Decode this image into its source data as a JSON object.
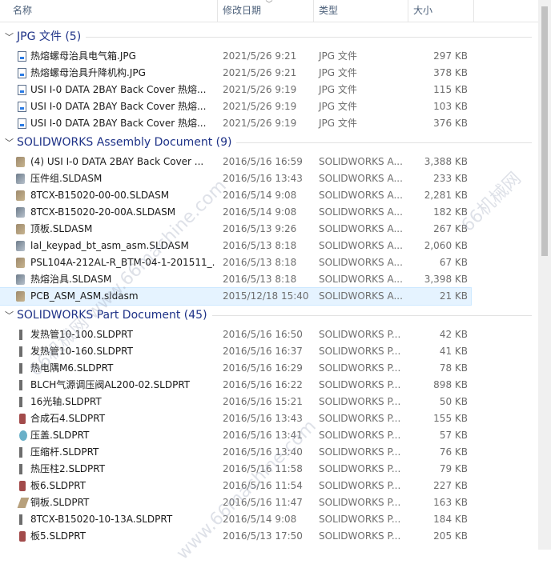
{
  "header": {
    "name": "名称",
    "date": "修改日期",
    "type": "类型",
    "size": "大小"
  },
  "groups": [
    {
      "title": "JPG 文件 (5)",
      "rows": [
        {
          "name": "热熔螺母治具电气箱.JPG",
          "date": "2021/5/26 9:21",
          "type": "JPG 文件",
          "size": "297 KB",
          "icon": "jpg-file-icon"
        },
        {
          "name": "热熔螺母治具升降机构.JPG",
          "date": "2021/5/26 9:21",
          "type": "JPG 文件",
          "size": "378 KB",
          "icon": "jpg-file-icon"
        },
        {
          "name": "USI I-0 DATA 2BAY Back Cover 热熔...",
          "date": "2021/5/26 9:19",
          "type": "JPG 文件",
          "size": "115 KB",
          "icon": "jpg-file-icon"
        },
        {
          "name": "USI I-0 DATA 2BAY Back Cover 热熔...",
          "date": "2021/5/26 9:19",
          "type": "JPG 文件",
          "size": "103 KB",
          "icon": "jpg-file-icon"
        },
        {
          "name": "USI I-0 DATA 2BAY Back Cover 热熔...",
          "date": "2021/5/26 9:19",
          "type": "JPG 文件",
          "size": "376 KB",
          "icon": "jpg-file-icon"
        }
      ]
    },
    {
      "title": "SOLIDWORKS Assembly Document (9)",
      "rows": [
        {
          "name": "(4) USI I-0 DATA 2BAY Back Cover ...",
          "date": "2016/5/16 16:59",
          "type": "SOLIDWORKS A...",
          "size": "3,388 KB",
          "icon": "assembly-icon"
        },
        {
          "name": "压件组.SLDASM",
          "date": "2016/5/16 13:43",
          "type": "SOLIDWORKS A...",
          "size": "233 KB",
          "icon": "assembly-icon"
        },
        {
          "name": "8TCX-B15020-00-00.SLDASM",
          "date": "2016/5/14 9:08",
          "type": "SOLIDWORKS A...",
          "size": "2,281 KB",
          "icon": "assembly-icon"
        },
        {
          "name": "8TCX-B15020-20-00A.SLDASM",
          "date": "2016/5/14 9:08",
          "type": "SOLIDWORKS A...",
          "size": "182 KB",
          "icon": "assembly-icon"
        },
        {
          "name": "顶板.SLDASM",
          "date": "2016/5/13 9:26",
          "type": "SOLIDWORKS A...",
          "size": "267 KB",
          "icon": "assembly-icon"
        },
        {
          "name": "lal_keypad_bt_asm_asm.SLDASM",
          "date": "2016/5/13 8:18",
          "type": "SOLIDWORKS A...",
          "size": "2,060 KB",
          "icon": "assembly-icon"
        },
        {
          "name": "PSL104A-212AL-R_BTM-04-1-201511_...",
          "date": "2016/5/13 8:18",
          "type": "SOLIDWORKS A...",
          "size": "67 KB",
          "icon": "assembly-icon"
        },
        {
          "name": "热熔治具.SLDASM",
          "date": "2016/5/13 8:18",
          "type": "SOLIDWORKS A...",
          "size": "3,398 KB",
          "icon": "assembly-icon"
        },
        {
          "name": "PCB_ASM_ASM.sldasm",
          "date": "2015/12/18 15:40",
          "type": "SOLIDWORKS A...",
          "size": "21 KB",
          "icon": "assembly-icon",
          "selected": true
        }
      ]
    },
    {
      "title": "SOLIDWORKS Part Document (45)",
      "rows": [
        {
          "name": "发热管10-100.SLDPRT",
          "date": "2016/5/16 16:50",
          "type": "SOLIDWORKS P...",
          "size": "42 KB",
          "icon": "part-icon"
        },
        {
          "name": "发热管10-160.SLDPRT",
          "date": "2016/5/16 16:37",
          "type": "SOLIDWORKS P...",
          "size": "41 KB",
          "icon": "part-icon"
        },
        {
          "name": "热电隅M6.SLDPRT",
          "date": "2016/5/16 16:29",
          "type": "SOLIDWORKS P...",
          "size": "78 KB",
          "icon": "part-icon"
        },
        {
          "name": "BLCH气源调压阀AL200-02.SLDPRT",
          "date": "2016/5/16 16:22",
          "type": "SOLIDWORKS P...",
          "size": "898 KB",
          "icon": "part-icon"
        },
        {
          "name": "16光轴.SLDPRT",
          "date": "2016/5/16 15:21",
          "type": "SOLIDWORKS P...",
          "size": "50 KB",
          "icon": "part-icon"
        },
        {
          "name": "合成石4.SLDPRT",
          "date": "2016/5/16 13:43",
          "type": "SOLIDWORKS P...",
          "size": "155 KB",
          "icon": "part-icon"
        },
        {
          "name": "压盖.SLDPRT",
          "date": "2016/5/16 13:41",
          "type": "SOLIDWORKS P...",
          "size": "57 KB",
          "icon": "part-icon"
        },
        {
          "name": "压缩杆.SLDPRT",
          "date": "2016/5/16 13:40",
          "type": "SOLIDWORKS P...",
          "size": "76 KB",
          "icon": "part-icon"
        },
        {
          "name": "热压柱2.SLDPRT",
          "date": "2016/5/16 11:58",
          "type": "SOLIDWORKS P...",
          "size": "79 KB",
          "icon": "part-icon"
        },
        {
          "name": "板6.SLDPRT",
          "date": "2016/5/16 11:54",
          "type": "SOLIDWORKS P...",
          "size": "227 KB",
          "icon": "part-icon"
        },
        {
          "name": "铜板.SLDPRT",
          "date": "2016/5/16 11:47",
          "type": "SOLIDWORKS P...",
          "size": "163 KB",
          "icon": "part-icon"
        },
        {
          "name": "8TCX-B15020-10-13A.SLDPRT",
          "date": "2016/5/14 9:08",
          "type": "SOLIDWORKS P...",
          "size": "184 KB",
          "icon": "part-icon"
        },
        {
          "name": "板5.SLDPRT",
          "date": "2016/5/13 17:50",
          "type": "SOLIDWORKS P...",
          "size": "205 KB",
          "icon": "part-icon"
        }
      ]
    }
  ],
  "watermarks": [
    "66机械网 www.66machine.com",
    "www.66machine.com",
    "66机械网"
  ]
}
